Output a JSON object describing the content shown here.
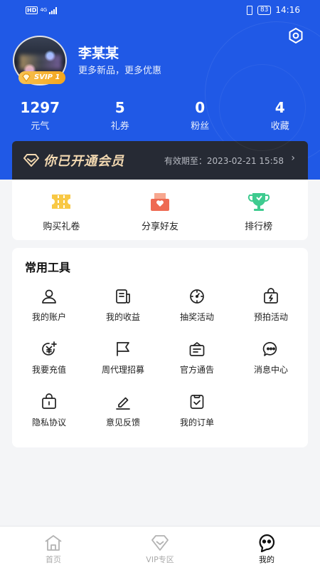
{
  "status_bar": {
    "hd": "HD",
    "network": "4G",
    "battery": "83",
    "time": "14:16"
  },
  "profile": {
    "name": "李某某",
    "tagline": "更多新品，更多优惠",
    "vip_level": "SVIP 1"
  },
  "stats": [
    {
      "value": "1297",
      "label": "元气"
    },
    {
      "value": "5",
      "label": "礼券"
    },
    {
      "value": "0",
      "label": "粉丝"
    },
    {
      "value": "4",
      "label": "收藏"
    }
  ],
  "vip_banner": {
    "title": "你已开通会员",
    "expiry": "有效期至：2023-02-21 15:58",
    "arrow": "›"
  },
  "quick_actions": [
    {
      "label": "购买礼卷",
      "icon": "ticket-icon"
    },
    {
      "label": "分享好友",
      "icon": "share-icon"
    },
    {
      "label": "排行榜",
      "icon": "trophy-icon"
    }
  ],
  "tools": {
    "title": "常用工具",
    "items": [
      {
        "label": "我的账户",
        "icon": "user-icon"
      },
      {
        "label": "我的收益",
        "icon": "earnings-icon"
      },
      {
        "label": "抽奖活动",
        "icon": "lottery-icon"
      },
      {
        "label": "预拍活动",
        "icon": "bag-bolt-icon"
      },
      {
        "label": "我要充值",
        "icon": "yen-plus-icon"
      },
      {
        "label": "周代理招募",
        "icon": "flag-icon"
      },
      {
        "label": "官方通告",
        "icon": "notice-icon"
      },
      {
        "label": "消息中心",
        "icon": "chat-icon"
      },
      {
        "label": "隐私协议",
        "icon": "lock-box-icon"
      },
      {
        "label": "意见反馈",
        "icon": "edit-icon"
      },
      {
        "label": "我的订单",
        "icon": "order-icon"
      }
    ]
  },
  "tabbar": [
    {
      "label": "首页",
      "icon": "home-icon",
      "active": false
    },
    {
      "label": "VIP专区",
      "icon": "diamond-icon",
      "active": false
    },
    {
      "label": "我的",
      "icon": "profile-icon",
      "active": true
    }
  ],
  "colors": {
    "brand_blue": "#2059e6",
    "vip_dark": "#262a34",
    "vip_gold": "#f3d9b1",
    "badge_gold": "#f4a51c"
  }
}
